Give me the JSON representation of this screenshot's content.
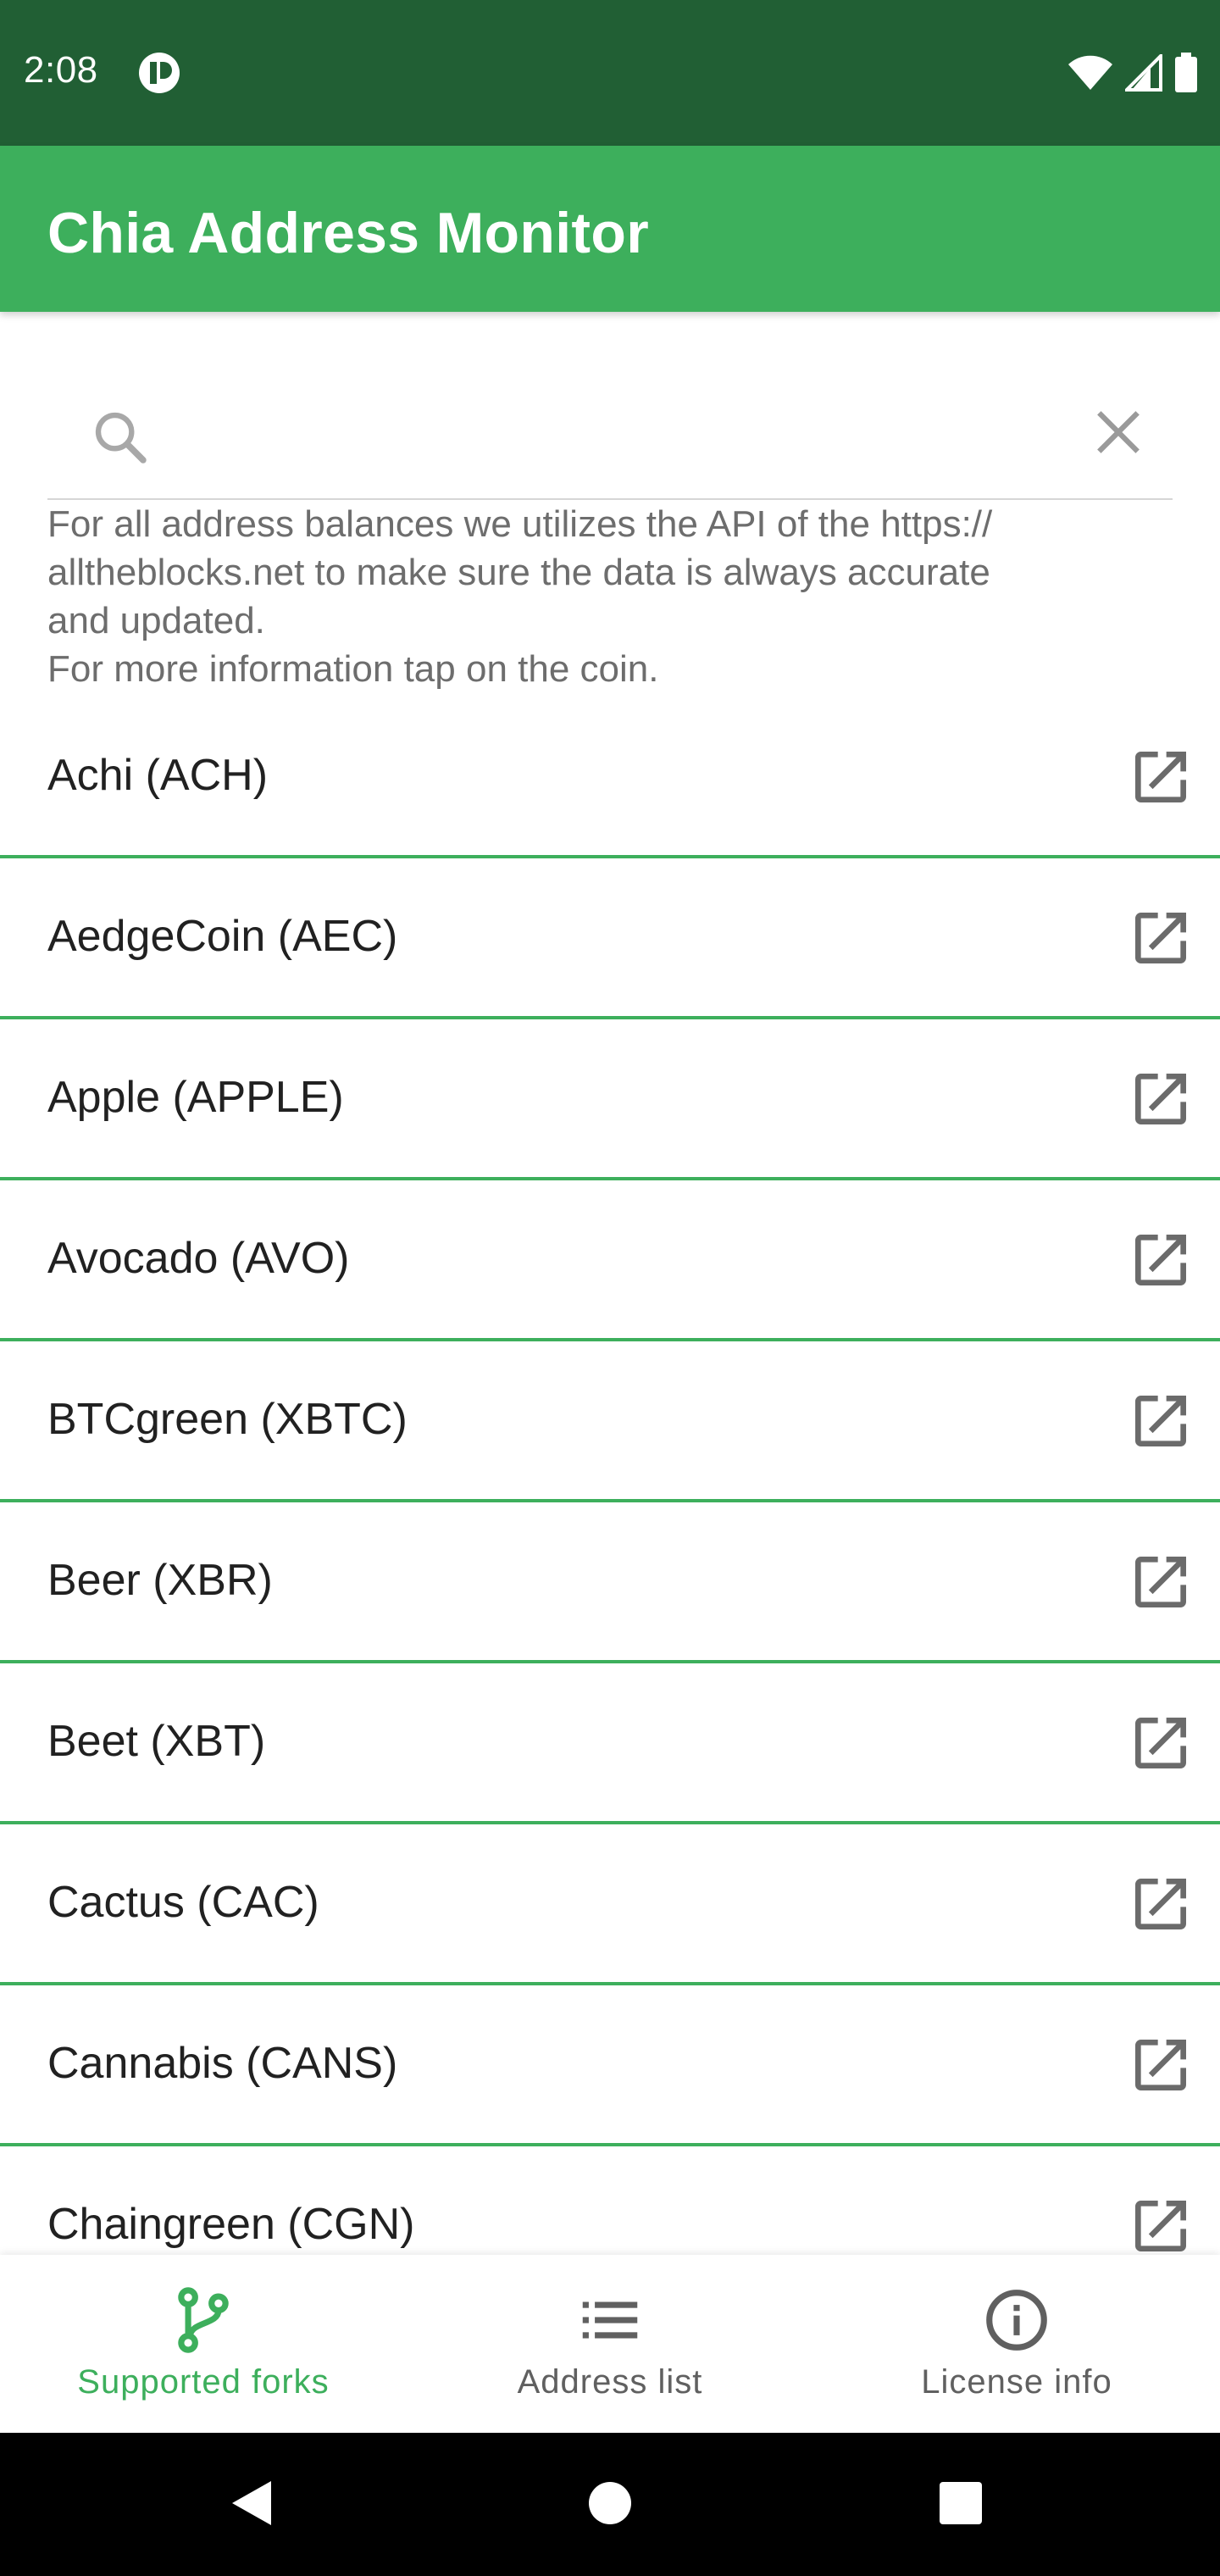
{
  "status_bar": {
    "time": "2:08",
    "icons": [
      "app-notification-icon",
      "wifi-icon",
      "cell-signal-icon",
      "battery-icon"
    ]
  },
  "app_bar": {
    "title": "Chia Address Monitor",
    "color": "#3daf5c",
    "status_color": "#215f34"
  },
  "search": {
    "value": "",
    "placeholder": "",
    "icon": "search-icon",
    "clear_icon": "close-icon"
  },
  "info": {
    "line1": "For all address balances we utilizes the API of the https://",
    "line2": "alltheblocks.net to make sure the data is always accurate",
    "line3": "and updated.",
    "line4": "For more information tap on the coin."
  },
  "coins": [
    {
      "label": "Achi (ACH)"
    },
    {
      "label": "AedgeCoin (AEC)"
    },
    {
      "label": "Apple (APPLE)"
    },
    {
      "label": "Avocado (AVO)"
    },
    {
      "label": "BTCgreen (XBTC)"
    },
    {
      "label": "Beer (XBR)"
    },
    {
      "label": "Beet (XBT)"
    },
    {
      "label": "Cactus (CAC)"
    },
    {
      "label": "Cannabis (CANS)"
    },
    {
      "label": "Chaingreen (CGN)"
    }
  ],
  "bottom_nav": {
    "items": [
      {
        "label": "Supported forks",
        "icon": "fork-branch-icon",
        "active": true
      },
      {
        "label": "Address list",
        "icon": "list-icon",
        "active": false
      },
      {
        "label": "License info",
        "icon": "info-icon",
        "active": false
      }
    ],
    "active_color": "#3daf5c",
    "inactive_color": "#606060"
  },
  "system_nav": {
    "icons": [
      "back-icon",
      "home-icon",
      "recents-icon"
    ]
  }
}
